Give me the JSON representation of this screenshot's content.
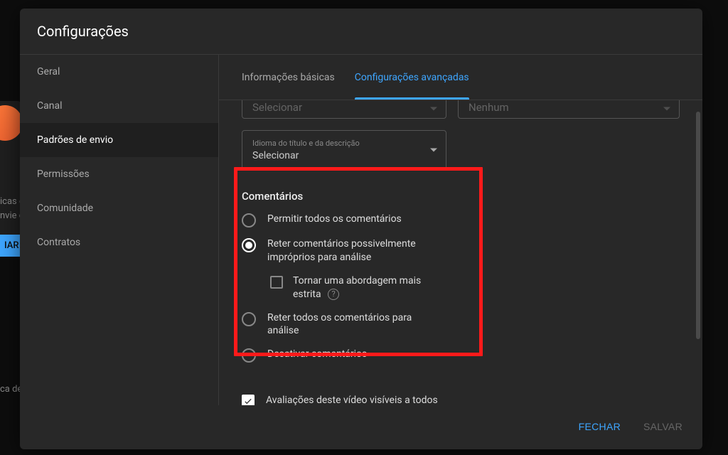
{
  "modal": {
    "title": "Configurações"
  },
  "sidebar": {
    "items": [
      {
        "label": "Geral"
      },
      {
        "label": "Canal"
      },
      {
        "label": "Padrões de envio"
      },
      {
        "label": "Permissões"
      },
      {
        "label": "Comunidade"
      },
      {
        "label": "Contratos"
      }
    ],
    "active_index": 2
  },
  "tabs": {
    "items": [
      {
        "label": "Informações básicas"
      },
      {
        "label": "Configurações avançadas"
      }
    ],
    "active_index": 1
  },
  "selects": {
    "partial_left": {
      "value": "Selecionar"
    },
    "partial_right": {
      "value": "Nenhum"
    },
    "lang": {
      "label": "Idioma do título e da descrição",
      "value": "Selecionar"
    }
  },
  "comments": {
    "section_title": "Comentários",
    "options": [
      {
        "label": "Permitir todos os comentários"
      },
      {
        "label": "Reter comentários possivelmente impróprios para análise"
      },
      {
        "label": "Reter todos os comentários para análise"
      },
      {
        "label": "Desativar comentários"
      }
    ],
    "selected_index": 1,
    "strict": {
      "label": "Tornar uma abordagem mais estrita",
      "checked": false
    }
  },
  "ratings": {
    "label": "Avaliações deste vídeo visíveis a todos",
    "checked": true
  },
  "footer": {
    "close": "FECHAR",
    "save": "SALVAR"
  },
  "background": {
    "text1": "icas e",
    "text2": "nvie e",
    "btn": "IAR",
    "low": "ca de"
  }
}
